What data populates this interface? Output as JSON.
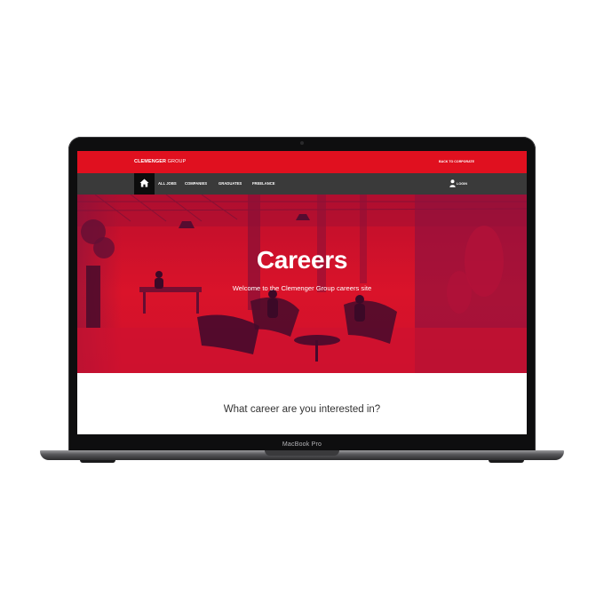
{
  "device": {
    "model_label": "MacBook Pro"
  },
  "site": {
    "logo": {
      "bold": "CLEMENGER",
      "regular": " GROUP"
    },
    "back_link": "BACK TO CORPORATE",
    "nav": {
      "home_icon": "home-icon",
      "items": [
        "ALL JOBS",
        "COMPANIES",
        "GRADUATES",
        "FREELANCE"
      ],
      "login_icon": "user-icon",
      "login_label": "LOGIN"
    },
    "hero": {
      "title": "Careers",
      "subtitle": "Welcome to the Clemenger Group careers site"
    },
    "section": {
      "question": "What career are you interested in?"
    }
  },
  "colors": {
    "brand_red": "#e0101f",
    "nav_bg": "#3a3a3a",
    "home_bg": "#0c0c0c",
    "hero_tint": "#d8102a"
  }
}
